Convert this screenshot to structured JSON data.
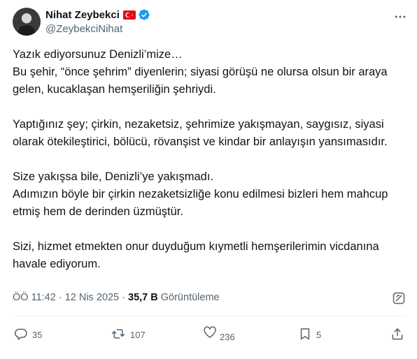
{
  "author": {
    "display_name": "Nihat Zeybekci",
    "handle": "@ZeybekciNihat",
    "flag_icon": "turkey-flag-icon",
    "verified_icon": "verified-badge-icon",
    "verified_color": "#1d9bf0"
  },
  "tweet": {
    "text": "Yazık ediyorsunuz Denizli’mize…\nBu şehir, “önce şehrim” diyenlerin; siyasi görüşü ne olursa olsun bir araya gelen, kucaklaşan hemşeriliğin şehriydi.\n\nYaptığınız şey; çirkin, nezaketsiz, şehrimize yakışmayan, saygısız, siyasi olarak ötekileştirici, bölücü, rövanşist ve kindar bir anlayışın yansımasıdır.\n\nSize yakışsa bile, Denizli’ye yakışmadı.\nAdımızın böyle bir çirkin nezaketsizliğe konu edilmesi bizleri hem mahcup etmiş hem de derinden üzmüştür.\n\nSizi, hizmet etmekten onur duyduğum kıymetli hemşerilerimin vicdanına havale ediyorum."
  },
  "meta": {
    "time": "ÖÖ 11:42",
    "separator": "·",
    "date": "12 Nis 2025",
    "views_count": "35,7 B",
    "views_label": "Görüntüleme"
  },
  "actions": {
    "replies": "35",
    "retweets": "107",
    "likes": "236",
    "bookmarks": "5"
  },
  "icons": {
    "more": "more-horizontal-icon",
    "grok": "grok-icon",
    "reply": "reply-icon",
    "retweet": "retweet-icon",
    "like": "heart-icon",
    "bookmark": "bookmark-icon",
    "share": "share-icon"
  },
  "colors": {
    "text": "#0f1419",
    "secondary": "#536471",
    "accent": "#1d9bf0",
    "divider": "#eff3f4"
  }
}
